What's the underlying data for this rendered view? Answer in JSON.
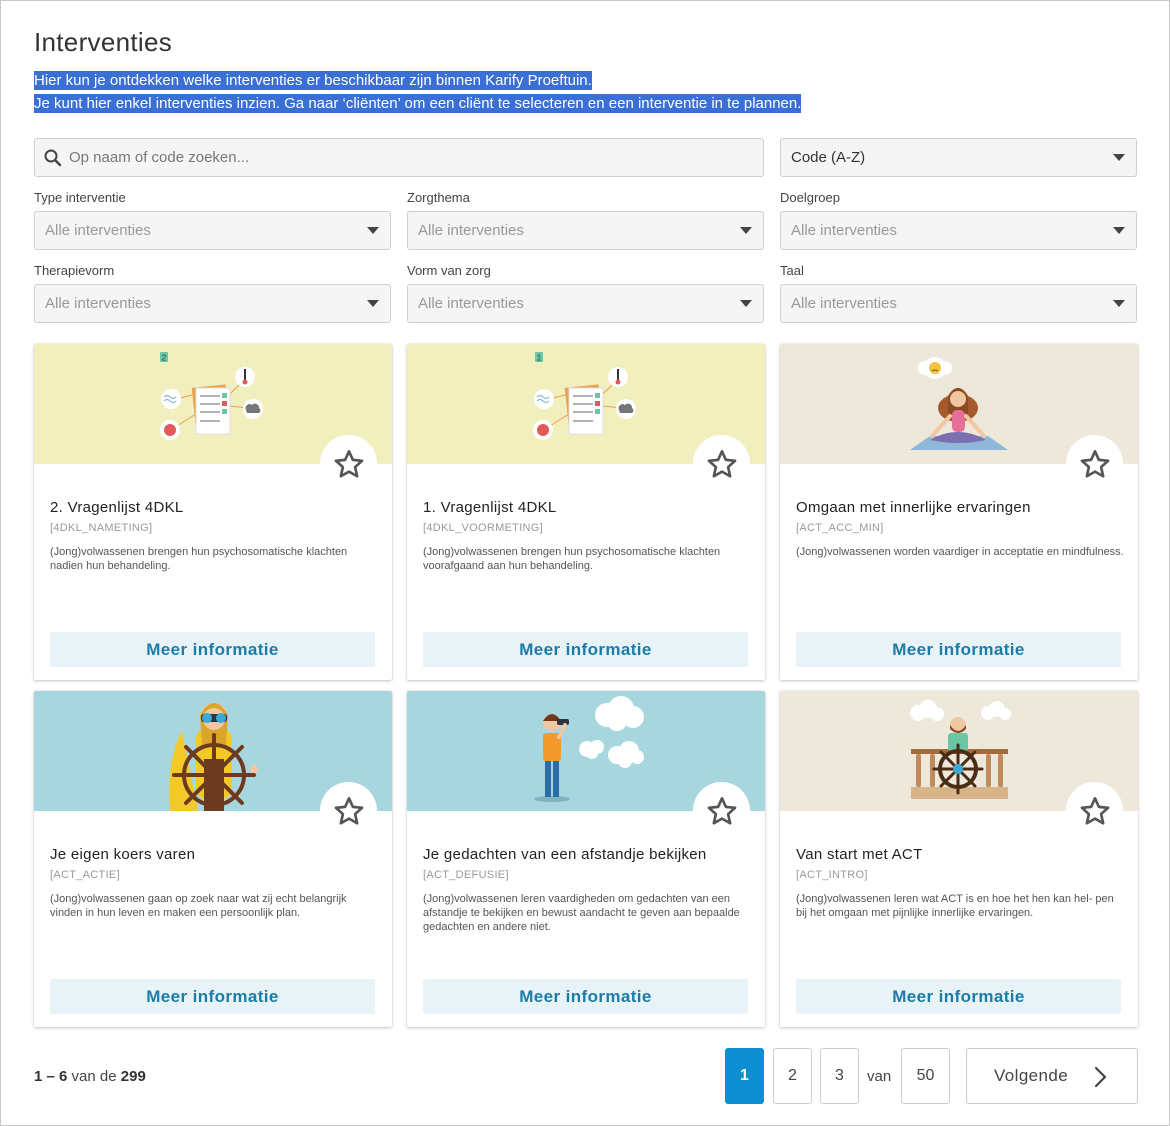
{
  "page": {
    "title": "Interventies",
    "intro_line1": "Hier kun je ontdekken welke interventies er beschikbaar zijn binnen Karify Proeftuin.",
    "intro_line2": "Je kunt hier enkel interventies inzien. Ga naar ‘cliënten’ om een cliënt te selecteren en een interventie in te plannen."
  },
  "search": {
    "placeholder": "Op naam of code zoeken...",
    "icon": "search-icon"
  },
  "sort": {
    "value": "Code (A-Z)"
  },
  "filters": [
    {
      "label": "Type interventie",
      "value": "Alle interventies"
    },
    {
      "label": "Zorgthema",
      "value": "Alle interventies"
    },
    {
      "label": "Doelgroep",
      "value": "Alle interventies"
    },
    {
      "label": "Therapievorm",
      "value": "Alle interventies"
    },
    {
      "label": "Vorm van zorg",
      "value": "Alle interventies"
    },
    {
      "label": "Taal",
      "value": "Alle interventies"
    }
  ],
  "cards": [
    {
      "title": "2. Vragenlijst 4DKL",
      "code": "[4DKL_NAMETING]",
      "description": "(Jong)volwassenen brengen hun psychosomatische klachten nadien hun behandeling.",
      "button": "Meer informatie",
      "banner_color": "#f2efbf",
      "illustration": "questionnaire-illustration",
      "badge": "2"
    },
    {
      "title": "1. Vragenlijst 4DKL",
      "code": "[4DKL_VOORMETING]",
      "description": "(Jong)volwassenen brengen hun psychosomatische klachten voorafgaand aan hun behandeling.",
      "button": "Meer informatie",
      "banner_color": "#f2efbf",
      "illustration": "questionnaire-illustration",
      "badge": "1"
    },
    {
      "title": "Omgaan met innerlijke ervaringen",
      "code": "[ACT_ACC_MIN]",
      "description": "(Jong)volwassenen worden vaardiger in acceptatie en mindfulness.",
      "button": "Meer informatie",
      "banner_color": "#ede8da",
      "illustration": "meditation-illustration"
    },
    {
      "title": "Je eigen koers varen",
      "code": "[ACT_ACTIE]",
      "description": "(Jong)volwassenen gaan op zoek naar wat zij echt belangrijk vinden in hun leven en maken een persoonlijk plan.",
      "button": "Meer informatie",
      "banner_color": "#a8d6de",
      "illustration": "ship-wheel-illustration"
    },
    {
      "title": "Je gedachten van een afstandje bekijken",
      "code": "[ACT_DEFUSIE]",
      "description": "(Jong)volwassenen leren vaardigheden om gedachten van een afstandje te bekijken en bewust aandacht te geven aan bepaalde gedachten en andere niet.",
      "button": "Meer informatie",
      "banner_color": "#a8d6de",
      "illustration": "thought-clouds-illustration"
    },
    {
      "title": "Van start met ACT",
      "code": "[ACT_INTRO]",
      "description": "(Jong)volwassenen leren wat ACT is en hoe het hen kan hel- pen bij het omgaan met pijnlijke innerlijke ervaringen.",
      "button": "Meer informatie",
      "banner_color": "#ede8da",
      "illustration": "captain-illustration"
    }
  ],
  "pagination": {
    "range": "1 – 6",
    "of_text": "van de",
    "total": "299",
    "pages": [
      "1",
      "2",
      "3"
    ],
    "active_page": "1",
    "van": "van",
    "last_page": "50",
    "next_label": "Volgende"
  },
  "colors": {
    "accent": "#0e8fd1",
    "selection": "#3a6fd6",
    "button_bg": "#e8f3f8",
    "button_text": "#1b7ca8"
  }
}
